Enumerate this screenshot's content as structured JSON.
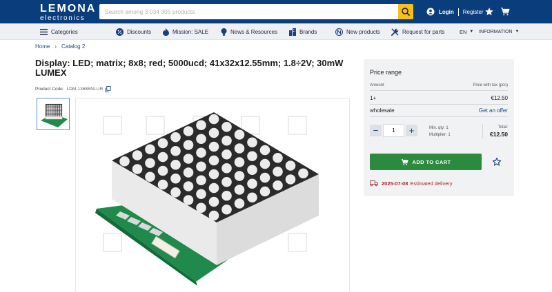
{
  "logo": {
    "line1": "LEMONA",
    "line2": "electronics"
  },
  "search": {
    "placeholder": "Search among 3 034 305 products"
  },
  "account": {
    "login": "Login",
    "register": "Register"
  },
  "nav": {
    "categories": "Categories",
    "discounts": "Discounts",
    "mission": "Mission: SALE",
    "news": "News & Resources",
    "brands": "Brands",
    "new_products": "New products",
    "request": "Request for parts",
    "lang": "EN",
    "information": "INFORMATION"
  },
  "breadcrumb": [
    "Home",
    "Catalog 2"
  ],
  "product": {
    "title": "Display: LED; matrix; 8x8; red; 5000ucd; 41x32x12.55mm; 1.8÷2V; 30mW LUMEX",
    "code_label": "Product Code:",
    "code": "LDM-1368BNI-UR"
  },
  "pricing": {
    "title": "Price range",
    "col_amount": "Amount",
    "col_price": "Price with tax (pcs)",
    "rows": [
      {
        "amount": "1+",
        "price": "€12.50"
      }
    ],
    "wholesale_label": "wholesale",
    "wholesale_link": "Get an offer",
    "quantity": "1",
    "min_qty": "Min. qty: 1",
    "multiplier": "Multiplier: 1",
    "total_label": "Total:",
    "total_value": "€12.50",
    "add_to_cart": "ADD TO CART",
    "delivery_date": "2025-07-08",
    "delivery_text": "Estimated delivery"
  },
  "colors": {
    "header_bg": "#0a3d7c",
    "search_button": "#f6bf1c",
    "add_to_cart": "#2c8a3e",
    "link": "#1b4b8c",
    "delivery": "#a32a2a",
    "led_off": "#ececec",
    "pcb": "#1f8a4c"
  },
  "icons": [
    "search-icon",
    "user-icon",
    "star-icon",
    "cart-icon",
    "menu-icon",
    "percent-icon",
    "fire-icon",
    "bulb-icon",
    "building-icon",
    "new-icon",
    "wrench-icon",
    "copy-icon",
    "truck-icon"
  ]
}
